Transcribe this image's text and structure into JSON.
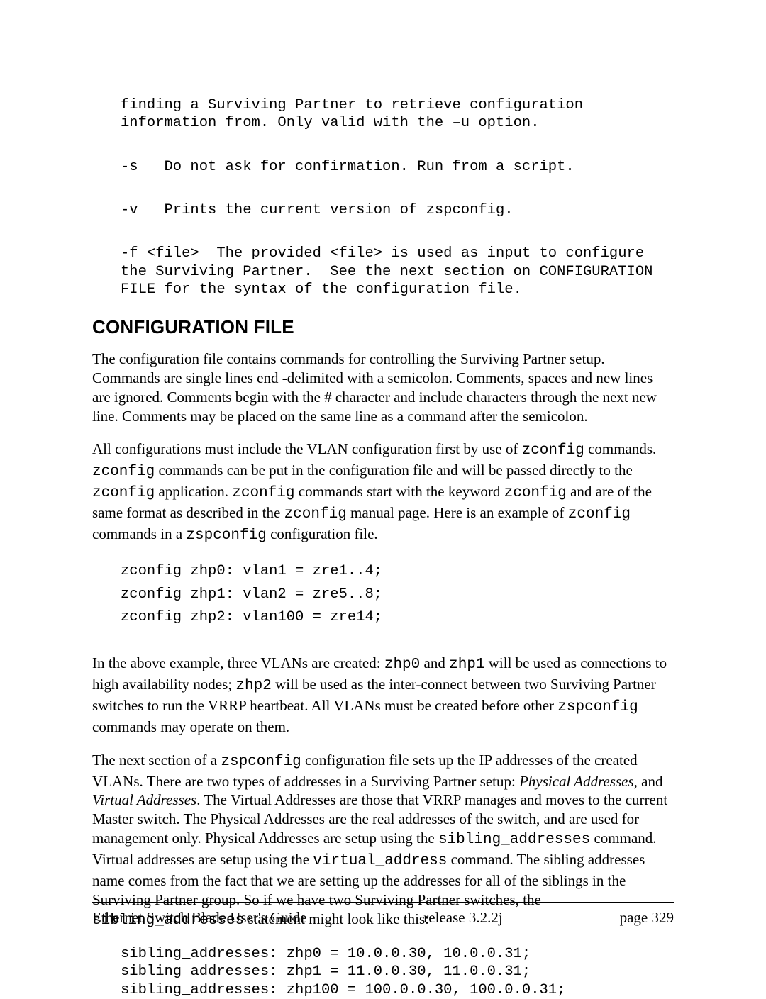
{
  "optionsBlock": {
    "l1": "finding a Surviving Partner to retrieve configuration",
    "l2": "information from. Only valid with the –u option.",
    "l3": "-s   Do not ask for confirmation. Run from a script.",
    "l4": "-v   Prints the current version of zspconfig.",
    "l5": "-f <file>  The provided <file> is used as input to configure",
    "l6": "the Surviving Partner.  See the next section on CONFIGURATION",
    "l7": "FILE for the syntax of the configuration file."
  },
  "heading": "CONFIGURATION FILE",
  "para1": "The configuration file contains commands for controlling the Surviving Partner setup. Commands are single lines end -delimited with a semicolon.  Comments, spaces and new lines are ignored. Comments begin with the # character and include characters through the next new line. Comments may be placed on the same line as a command after the semicolon.",
  "p2": {
    "t1": "All configurations must include the VLAN configuration first by use of ",
    "c1": "zconfig",
    "t2": " commands. ",
    "c2": "zconfig",
    "t3": " commands can be put in the configuration file and will be passed directly to the ",
    "c3": "zconfig",
    "t4": " application. ",
    "c4": "zconfig",
    "t5": " commands start with the keyword ",
    "c5": "zconfig",
    "t6": " and are of the same format as described in the ",
    "c6": "zconfig",
    "t7": " manual page.  Here is an example of ",
    "c7": "zconfig",
    "t8": " commands in a ",
    "c8": "zspconfig",
    "t9": " configuration file."
  },
  "codeA": {
    "l1": "zconfig zhp0: vlan1 = zre1..4;",
    "l2": "zconfig zhp1: vlan2 = zre5..8;",
    "l3": "zconfig zhp2: vlan100 = zre14;"
  },
  "p3": {
    "t1": "In the above example, three VLANs are created:  ",
    "c1": "zhp0",
    "t2": " and ",
    "c2": "zhp1",
    "t3": " will be used as connections to high availability nodes; ",
    "c3": "zhp2",
    "t4": " will be used as the inter-connect between two Surviving Partner switches to run the VRRP heartbeat.  All VLANs must be created before other ",
    "c4": "zspconfig",
    "t5": " commands may operate on them."
  },
  "p4": {
    "t1": "The next section of a ",
    "c1": "zspconfig",
    "t2": " configuration file sets up the IP addresses of the created VLANs.  There are two types of addresses in a Surviving Partner setup: ",
    "e1": "Physical Addresses",
    "t3": ", and ",
    "e2": "Virtual Addresses",
    "t4": ".  The Virtual Addresses are those that VRRP manages and moves to the current Master switch.  The Physical Addresses are the real addresses of the switch, and are used for management only.  Physical Addresses are setup using the ",
    "c2": "sibling_addresses",
    "t5": " command. Virtual addresses are setup using the ",
    "c3": "virtual_address",
    "t6": " command.  The sibling addresses name comes from the fact that we are setting up the addresses for all of the siblings in the Surviving Partner group.  So if we have two Surviving Partner switches, the ",
    "c4": "sibling_addresses",
    "t7": " statement might look like this:"
  },
  "codeB": {
    "l1": "sibling_addresses: zhp0 = 10.0.0.30, 10.0.0.31;",
    "l2": "sibling_addresses: zhp1 = 11.0.0.30, 11.0.0.31;",
    "l3": "sibling_addresses: zhp100 = 100.0.0.30, 100.0.0.31;"
  },
  "footer": {
    "left": "Ethernet Switch Blade User's Guide",
    "mid": "release  3.2.2j",
    "right": "page  329"
  }
}
